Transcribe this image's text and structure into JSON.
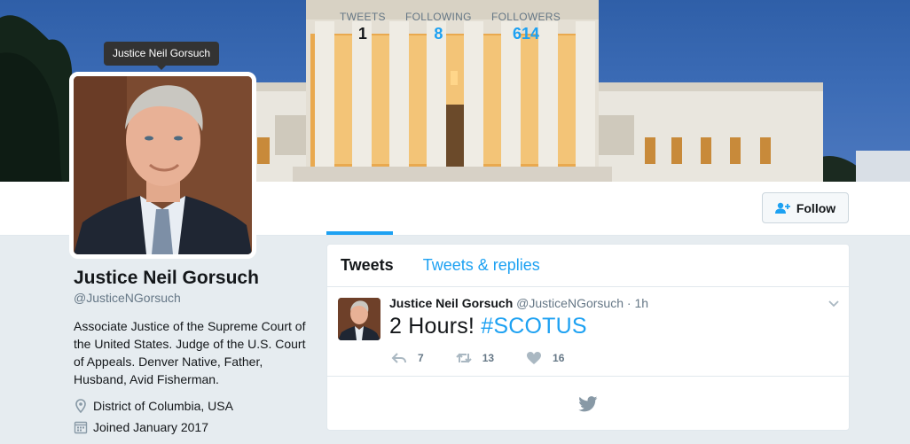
{
  "tooltip": {
    "text": "Justice Neil Gorsuch"
  },
  "nav": {
    "stats": [
      {
        "label": "TWEETS",
        "value": "1"
      },
      {
        "label": "FOLLOWING",
        "value": "8"
      },
      {
        "label": "FOLLOWERS",
        "value": "614"
      }
    ],
    "follow_label": "Follow"
  },
  "profile": {
    "name": "Justice Neil Gorsuch",
    "handle": "@JusticeNGorsuch",
    "bio": "Associate Justice of the Supreme Court of the United States. Judge of the U.S. Court of Appeals. Denver Native, Father, Husband, Avid Fisherman.",
    "location": "District of Columbia, USA",
    "joined": "Joined January 2017"
  },
  "timeline": {
    "tabs": [
      {
        "label": "Tweets"
      },
      {
        "label": "Tweets & replies"
      }
    ],
    "tweet": {
      "name": "Justice Neil Gorsuch",
      "handle": "@JusticeNGorsuch",
      "dot": "·",
      "time": "1h",
      "text_plain": "2 Hours!",
      "hashtag": "#SCOTUS",
      "reply_count": "7",
      "retweet_count": "13",
      "like_count": "16"
    }
  },
  "colors": {
    "accent": "#1da1f2",
    "text": "#14171a",
    "muted": "#657786",
    "background": "#e6ecf0"
  },
  "icons": [
    "location-pin-icon",
    "calendar-icon",
    "add-user-icon",
    "reply-icon",
    "retweet-icon",
    "heart-icon",
    "chevron-down-icon",
    "twitter-bird-icon"
  ]
}
